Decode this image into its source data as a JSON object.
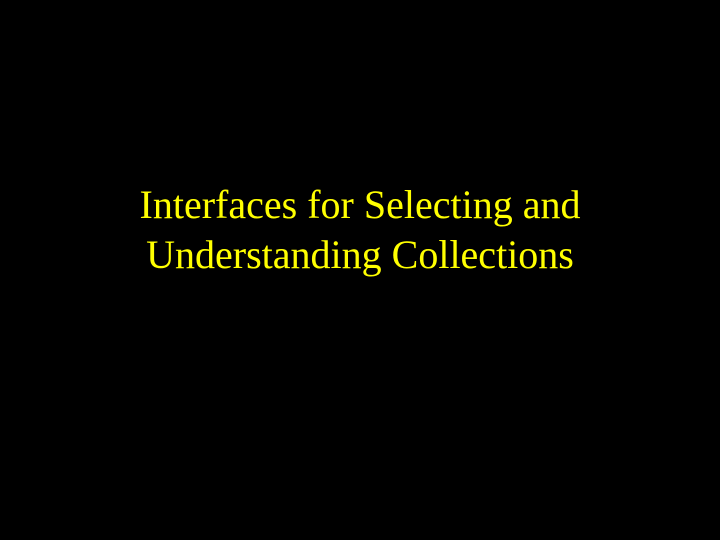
{
  "slide": {
    "title_line1": "Interfaces for Selecting and",
    "title_line2": "Understanding Collections"
  }
}
